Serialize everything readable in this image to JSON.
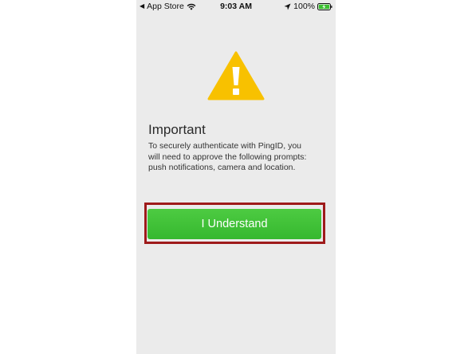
{
  "status_bar": {
    "back_app": "App Store",
    "time": "9:03 AM",
    "battery": "100%",
    "icons": [
      "back-caret-icon",
      "wifi-icon",
      "location-arrow-icon",
      "battery-charging-icon"
    ]
  },
  "alert": {
    "icon": "warning-icon",
    "icon_color": "#f8c100",
    "title": "Important",
    "message_lines": [
      "To securely authenticate with PingID, you",
      "will need to approve the following prompts:",
      "push notifications, camera and location."
    ],
    "button_label": "I Understand",
    "button_color": "#3cc035",
    "highlight_color": "#9e1a1a"
  }
}
